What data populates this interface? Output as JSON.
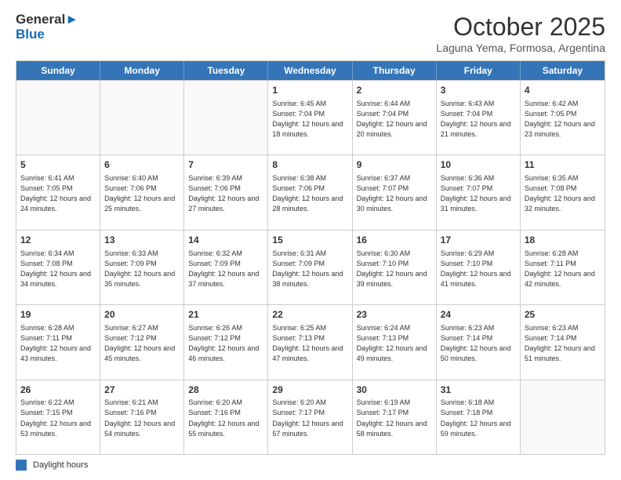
{
  "header": {
    "logo_line1": "General",
    "logo_line2": "Blue",
    "month": "October 2025",
    "location": "Laguna Yema, Formosa, Argentina"
  },
  "weekdays": [
    "Sunday",
    "Monday",
    "Tuesday",
    "Wednesday",
    "Thursday",
    "Friday",
    "Saturday"
  ],
  "legend": {
    "label": "Daylight hours"
  },
  "weeks": [
    [
      {
        "day": "",
        "info": ""
      },
      {
        "day": "",
        "info": ""
      },
      {
        "day": "",
        "info": ""
      },
      {
        "day": "1",
        "info": "Sunrise: 6:45 AM\nSunset: 7:04 PM\nDaylight: 12 hours\nand 18 minutes."
      },
      {
        "day": "2",
        "info": "Sunrise: 6:44 AM\nSunset: 7:04 PM\nDaylight: 12 hours\nand 20 minutes."
      },
      {
        "day": "3",
        "info": "Sunrise: 6:43 AM\nSunset: 7:04 PM\nDaylight: 12 hours\nand 21 minutes."
      },
      {
        "day": "4",
        "info": "Sunrise: 6:42 AM\nSunset: 7:05 PM\nDaylight: 12 hours\nand 23 minutes."
      }
    ],
    [
      {
        "day": "5",
        "info": "Sunrise: 6:41 AM\nSunset: 7:05 PM\nDaylight: 12 hours\nand 24 minutes."
      },
      {
        "day": "6",
        "info": "Sunrise: 6:40 AM\nSunset: 7:06 PM\nDaylight: 12 hours\nand 25 minutes."
      },
      {
        "day": "7",
        "info": "Sunrise: 6:39 AM\nSunset: 7:06 PM\nDaylight: 12 hours\nand 27 minutes."
      },
      {
        "day": "8",
        "info": "Sunrise: 6:38 AM\nSunset: 7:06 PM\nDaylight: 12 hours\nand 28 minutes."
      },
      {
        "day": "9",
        "info": "Sunrise: 6:37 AM\nSunset: 7:07 PM\nDaylight: 12 hours\nand 30 minutes."
      },
      {
        "day": "10",
        "info": "Sunrise: 6:36 AM\nSunset: 7:07 PM\nDaylight: 12 hours\nand 31 minutes."
      },
      {
        "day": "11",
        "info": "Sunrise: 6:35 AM\nSunset: 7:08 PM\nDaylight: 12 hours\nand 32 minutes."
      }
    ],
    [
      {
        "day": "12",
        "info": "Sunrise: 6:34 AM\nSunset: 7:08 PM\nDaylight: 12 hours\nand 34 minutes."
      },
      {
        "day": "13",
        "info": "Sunrise: 6:33 AM\nSunset: 7:09 PM\nDaylight: 12 hours\nand 35 minutes."
      },
      {
        "day": "14",
        "info": "Sunrise: 6:32 AM\nSunset: 7:09 PM\nDaylight: 12 hours\nand 37 minutes."
      },
      {
        "day": "15",
        "info": "Sunrise: 6:31 AM\nSunset: 7:09 PM\nDaylight: 12 hours\nand 38 minutes."
      },
      {
        "day": "16",
        "info": "Sunrise: 6:30 AM\nSunset: 7:10 PM\nDaylight: 12 hours\nand 39 minutes."
      },
      {
        "day": "17",
        "info": "Sunrise: 6:29 AM\nSunset: 7:10 PM\nDaylight: 12 hours\nand 41 minutes."
      },
      {
        "day": "18",
        "info": "Sunrise: 6:28 AM\nSunset: 7:11 PM\nDaylight: 12 hours\nand 42 minutes."
      }
    ],
    [
      {
        "day": "19",
        "info": "Sunrise: 6:28 AM\nSunset: 7:11 PM\nDaylight: 12 hours\nand 43 minutes."
      },
      {
        "day": "20",
        "info": "Sunrise: 6:27 AM\nSunset: 7:12 PM\nDaylight: 12 hours\nand 45 minutes."
      },
      {
        "day": "21",
        "info": "Sunrise: 6:26 AM\nSunset: 7:12 PM\nDaylight: 12 hours\nand 46 minutes."
      },
      {
        "day": "22",
        "info": "Sunrise: 6:25 AM\nSunset: 7:13 PM\nDaylight: 12 hours\nand 47 minutes."
      },
      {
        "day": "23",
        "info": "Sunrise: 6:24 AM\nSunset: 7:13 PM\nDaylight: 12 hours\nand 49 minutes."
      },
      {
        "day": "24",
        "info": "Sunrise: 6:23 AM\nSunset: 7:14 PM\nDaylight: 12 hours\nand 50 minutes."
      },
      {
        "day": "25",
        "info": "Sunrise: 6:23 AM\nSunset: 7:14 PM\nDaylight: 12 hours\nand 51 minutes."
      }
    ],
    [
      {
        "day": "26",
        "info": "Sunrise: 6:22 AM\nSunset: 7:15 PM\nDaylight: 12 hours\nand 53 minutes."
      },
      {
        "day": "27",
        "info": "Sunrise: 6:21 AM\nSunset: 7:16 PM\nDaylight: 12 hours\nand 54 minutes."
      },
      {
        "day": "28",
        "info": "Sunrise: 6:20 AM\nSunset: 7:16 PM\nDaylight: 12 hours\nand 55 minutes."
      },
      {
        "day": "29",
        "info": "Sunrise: 6:20 AM\nSunset: 7:17 PM\nDaylight: 12 hours\nand 57 minutes."
      },
      {
        "day": "30",
        "info": "Sunrise: 6:19 AM\nSunset: 7:17 PM\nDaylight: 12 hours\nand 58 minutes."
      },
      {
        "day": "31",
        "info": "Sunrise: 6:18 AM\nSunset: 7:18 PM\nDaylight: 12 hours\nand 59 minutes."
      },
      {
        "day": "",
        "info": ""
      }
    ]
  ]
}
